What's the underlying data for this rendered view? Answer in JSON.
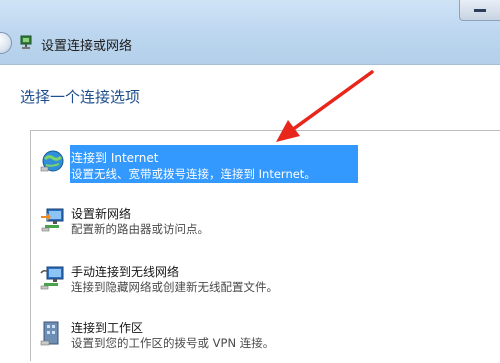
{
  "window": {
    "title": "设置连接或网络"
  },
  "main": {
    "heading": "选择一个连接选项"
  },
  "options": [
    {
      "label": "连接到 Internet",
      "description": "设置无线、宽带或拨号连接，连接到 Internet。",
      "icon": "globe-network-icon",
      "selected": true
    },
    {
      "label": "设置新网络",
      "description": "配置新的路由器或访问点。",
      "icon": "new-network-icon",
      "selected": false
    },
    {
      "label": "手动连接到无线网络",
      "description": "连接到隐藏网络或创建新无线配置文件。",
      "icon": "wireless-network-icon",
      "selected": false
    },
    {
      "label": "连接到工作区",
      "description": "设置到您的工作区的拨号或 VPN 连接。",
      "icon": "workplace-icon",
      "selected": false
    }
  ],
  "colors": {
    "selection": "#3399ff",
    "heading": "#1f4e8c",
    "annotation_arrow": "#e8261b"
  }
}
